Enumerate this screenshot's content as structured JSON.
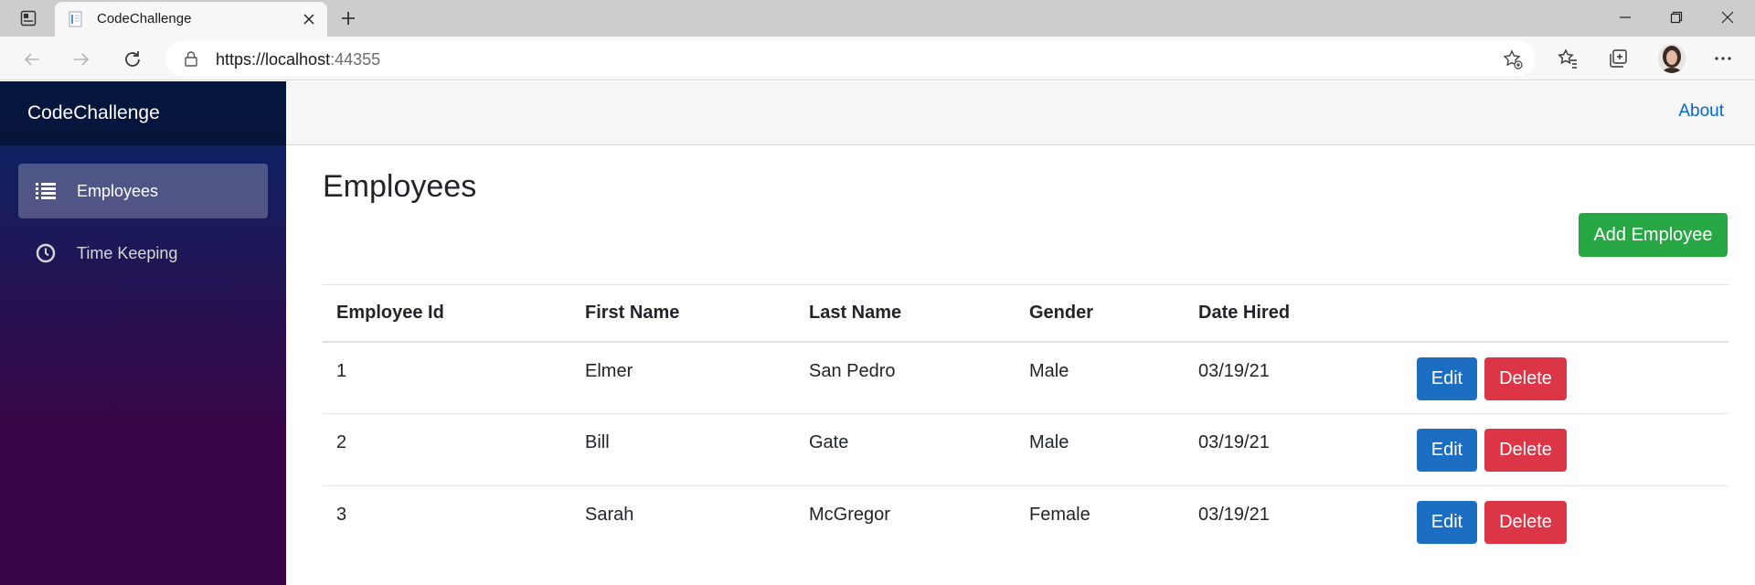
{
  "browser": {
    "tab_title": "CodeChallenge",
    "url_host": "https://localhost",
    "url_port": ":44355"
  },
  "app": {
    "brand": "CodeChallenge",
    "nav": [
      {
        "label": "Employees",
        "icon": "list-icon",
        "active": true
      },
      {
        "label": "Time Keeping",
        "icon": "clock-icon",
        "active": false
      }
    ],
    "top_link": "About"
  },
  "page": {
    "title": "Employees",
    "add_button": "Add Employee"
  },
  "table": {
    "headers": [
      "Employee Id",
      "First Name",
      "Last Name",
      "Gender",
      "Date Hired",
      ""
    ],
    "rows": [
      {
        "id": "1",
        "first": "Elmer",
        "last": "San Pedro",
        "gender": "Male",
        "hired": "03/19/21"
      },
      {
        "id": "2",
        "first": "Bill",
        "last": "Gate",
        "gender": "Male",
        "hired": "03/19/21"
      },
      {
        "id": "3",
        "first": "Sarah",
        "last": "McGregor",
        "gender": "Female",
        "hired": "03/19/21"
      }
    ],
    "edit_label": "Edit",
    "delete_label": "Delete"
  },
  "colors": {
    "success": "#28a745",
    "primary": "#1b6ec2",
    "danger": "#dc3545",
    "link": "#0366d6"
  }
}
